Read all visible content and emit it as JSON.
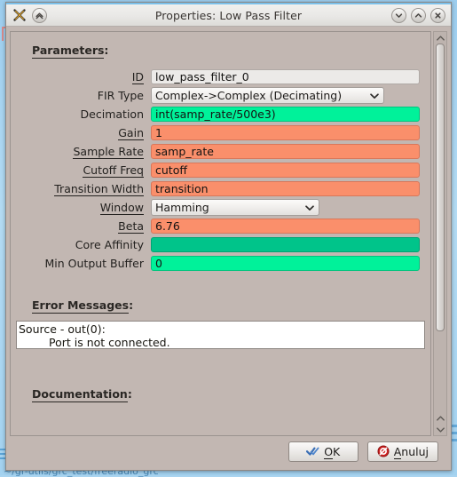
{
  "window": {
    "title": "Properties: Low Pass Filter",
    "logo_icon": "gnuradio-x-logo-icon",
    "shade_button_icon": "collapse-chevrons-icon",
    "minimize_icon": "chevron-down-icon",
    "maximize_icon": "chevron-up-icon",
    "close_icon": "close-x-icon"
  },
  "desktop": {
    "background_text": "~/gr-utils/grc_test/freeradio_grc"
  },
  "sections": {
    "parameters_heading": "Parameters",
    "errors_heading": "Error Messages",
    "documentation_heading": "Documentation",
    "heading_colon": ":"
  },
  "parameters": [
    {
      "label": "ID",
      "underline": true,
      "type": "text",
      "value": "low_pass_filter_0",
      "style": "plain"
    },
    {
      "label": "FIR Type",
      "underline": false,
      "type": "combo",
      "value": "Complex->Complex (Decimating)",
      "style": "combo-wide"
    },
    {
      "label": "Decimation",
      "underline": false,
      "type": "text",
      "value": "int(samp_rate/500e3)",
      "style": "green"
    },
    {
      "label": "Gain",
      "underline": true,
      "type": "text",
      "value": "1",
      "style": "salmon"
    },
    {
      "label": "Sample Rate",
      "underline": true,
      "type": "text",
      "value": "samp_rate",
      "style": "salmon"
    },
    {
      "label": "Cutoff Freq",
      "underline": true,
      "type": "text",
      "value": "cutoff",
      "style": "salmon"
    },
    {
      "label": "Transition Width",
      "underline": true,
      "type": "text",
      "value": "transition",
      "style": "salmon"
    },
    {
      "label": "Window",
      "underline": true,
      "type": "combo",
      "value": "Hamming",
      "style": "combo-narrow"
    },
    {
      "label": "Beta",
      "underline": true,
      "type": "text",
      "value": "6.76",
      "style": "salmon"
    },
    {
      "label": "Core Affinity",
      "underline": false,
      "type": "text",
      "value": "",
      "style": "green-dark"
    },
    {
      "label": "Min Output Buffer",
      "underline": false,
      "type": "text",
      "value": "0",
      "style": "green"
    }
  ],
  "errors": {
    "line1": "Source - out(0):",
    "line2": "Port is not connected."
  },
  "buttons": {
    "ok": {
      "accel": "O",
      "rest": "K",
      "icon": "blue-check-icon"
    },
    "cancel": {
      "accel": "A",
      "rest": "nuluj",
      "icon": "red-cancel-icon"
    }
  },
  "scrollbar": {
    "up_icon": "chevron-up-icon",
    "down_icon": "chevron-down-icon"
  },
  "colors": {
    "valid_green": "#00f29a",
    "valid_green_dark": "#00c48a",
    "invalid_salmon": "#fa8f6b",
    "window_bg": "#c2b7b2"
  }
}
